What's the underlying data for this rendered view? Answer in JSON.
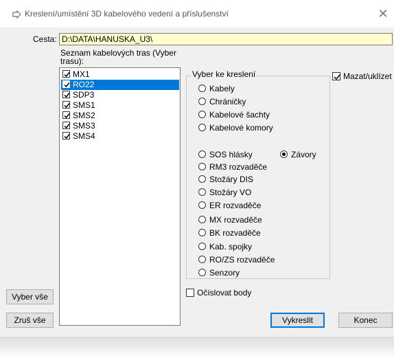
{
  "window": {
    "title": "Kreslení/umístění 3D kabelového vedení a příslušenství",
    "close_glyph": "✕"
  },
  "path": {
    "label": "Cesta:",
    "value": "D:\\DATA\\HANUSKA_U3\\"
  },
  "routes": {
    "label": "Seznam kabelových tras (Vyber trasu):",
    "items": [
      {
        "label": "MX1",
        "checked": true,
        "selected": false
      },
      {
        "label": "RO22",
        "checked": true,
        "selected": true
      },
      {
        "label": "SDP3",
        "checked": true,
        "selected": false
      },
      {
        "label": "SMS1",
        "checked": true,
        "selected": false
      },
      {
        "label": "SMS2",
        "checked": true,
        "selected": false
      },
      {
        "label": "SMS3",
        "checked": true,
        "selected": false
      },
      {
        "label": "SMS4",
        "checked": true,
        "selected": false
      }
    ]
  },
  "draw_group": {
    "label": "Vyber ke kreslení",
    "options": [
      {
        "label": "Kabely",
        "checked": false
      },
      {
        "label": "Chráničky",
        "checked": false
      },
      {
        "label": "Kabelové šachty",
        "checked": false
      },
      {
        "label": "Kabelové komory",
        "checked": false
      },
      {
        "label": "SOS hlásky",
        "checked": false
      },
      {
        "label": "Závory",
        "checked": true
      },
      {
        "label": "RM3 rozvaděče",
        "checked": false
      },
      {
        "label": "Stožáry DIS",
        "checked": false
      },
      {
        "label": "Stožáry VO",
        "checked": false
      },
      {
        "label": "ER rozvaděče",
        "checked": false
      },
      {
        "label": "MX rozvaděče",
        "checked": false
      },
      {
        "label": "BK rozvaděče",
        "checked": false
      },
      {
        "label": "Kab. spojky",
        "checked": false
      },
      {
        "label": "RO/ZS rozvaděče",
        "checked": false
      },
      {
        "label": "Senzory",
        "checked": false
      }
    ]
  },
  "options": {
    "mazat_label": "Mazat/uklízet",
    "mazat_checked": true,
    "ocislovat_label": "Očíslovat body",
    "ocislovat_checked": false
  },
  "buttons": {
    "select_all": "Vyber vše",
    "unselect_all": "Zruš vše",
    "draw": "Vykreslit",
    "end": "Konec"
  },
  "colors": {
    "selection": "#0078d7",
    "path_field_bg": "#ffffcc",
    "dialog_bg": "#f0f0f0"
  }
}
